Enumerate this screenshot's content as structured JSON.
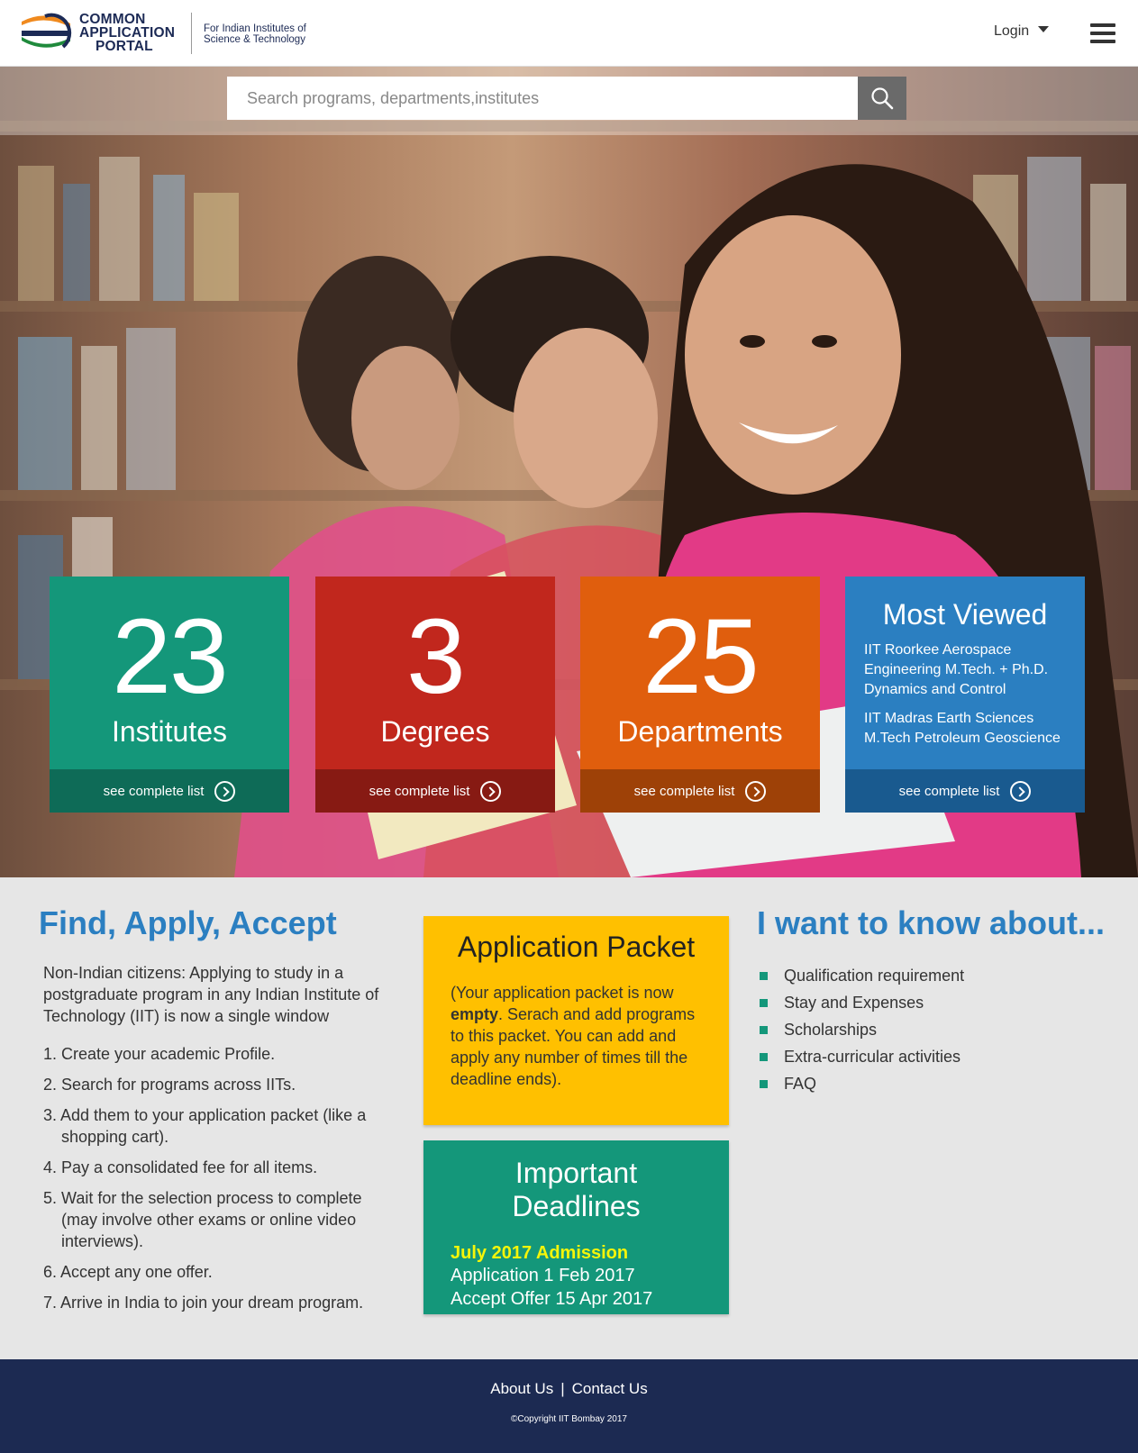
{
  "header": {
    "logo_text_line1": "COMMON",
    "logo_text_line2": "APPLICATION",
    "logo_text_line3": "PORTAL",
    "tagline_line1": "For Indian Institutes of",
    "tagline_line2": "Science & Technology",
    "login_label": "Login"
  },
  "search": {
    "placeholder": "Search programs, departments,institutes"
  },
  "tiles": {
    "institutes": {
      "number": "23",
      "label": "Institutes",
      "link": "see complete list"
    },
    "degrees": {
      "number": "3",
      "label": "Degrees",
      "link": "see complete list"
    },
    "departments": {
      "number": "25",
      "label": "Departments",
      "link": "see complete list"
    },
    "most_viewed": {
      "title": "Most Viewed",
      "items": [
        "IIT Roorkee Aerospace Engineering M.Tech. + Ph.D. Dynamics and Control",
        "IIT Madras Earth Sciences M.Tech Petroleum Geoscience"
      ],
      "link": "see complete list"
    }
  },
  "find_apply": {
    "heading": "Find, Apply, Accept",
    "intro": "Non-Indian citizens: Applying to study in a postgraduate program in any Indian Institute of Technology (IIT) is now a single window",
    "steps": [
      "1. Create your academic Profile.",
      "2. Search for programs across IITs.",
      "3. Add them to your application packet (like a shopping cart).",
      "4. Pay a consolidated fee for all items.",
      "5. Wait for the selection process to complete (may involve other exams or online video interviews).",
      "6. Accept any one offer.",
      "7. Arrive in India to join your dream program."
    ]
  },
  "packet": {
    "title": "Application Packet",
    "text_before": "(Your application packet is now ",
    "text_bold": "empty",
    "text_after": ". Serach and add programs to this packet. You can add and apply any number of times till the deadline ends)."
  },
  "deadlines": {
    "title": "Important Deadlines",
    "admission": "July 2017 Admission",
    "application": "Application 1 Feb 2017",
    "accept": "Accept Offer 15 Apr 2017"
  },
  "know_about": {
    "heading": "I want to know about...",
    "items": [
      "Qualification requirement",
      "Stay and Expenses",
      "Scholarships",
      "Extra-curricular activities",
      "FAQ"
    ]
  },
  "footer": {
    "about": "About Us",
    "separator": "|",
    "contact": "Contact Us",
    "copyright": "©Copyright IIT Bombay 2017"
  },
  "colors": {
    "green": "#14977a",
    "red": "#c1271d",
    "orange": "#e05e0d",
    "blue": "#2b7fc1",
    "yellow": "#ffc000",
    "navy": "#1c2a52"
  },
  "icons": {
    "search": "search-icon",
    "menu": "hamburger-menu-icon",
    "dropdown": "caret-down-icon",
    "arrow": "arrow-circle-right-icon"
  }
}
